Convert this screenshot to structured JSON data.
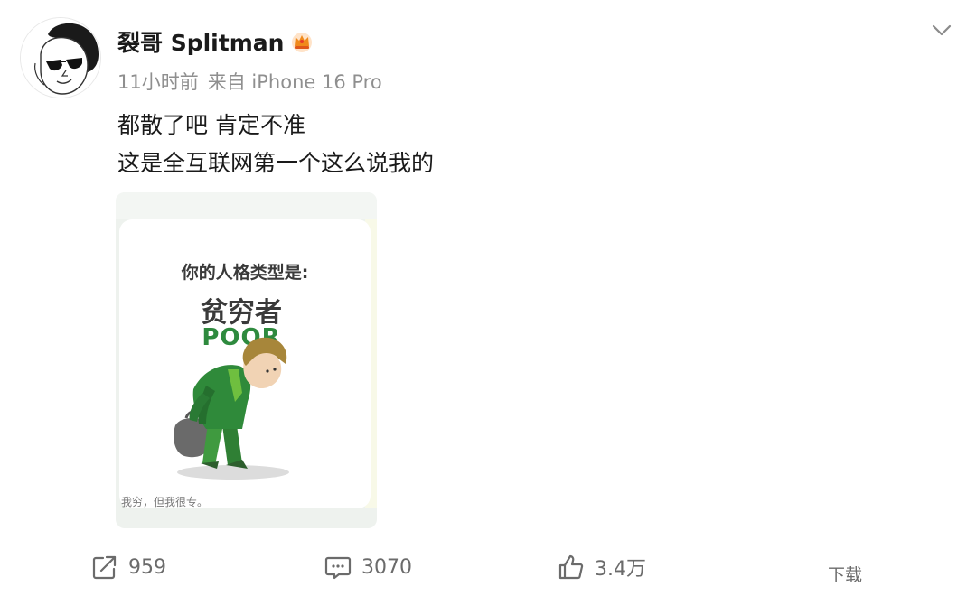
{
  "post": {
    "author": "裂哥 Splitman",
    "time": "11小时前",
    "source": "来自 iPhone 16 Pro",
    "text_line1": "都散了吧 肯定不准",
    "text_line2": "这是全互联网第一个这么说我的"
  },
  "image": {
    "heading": "你的人格类型是:",
    "type_cn": "贫穷者",
    "type_en": "POOR",
    "footer": "我穷，但我很专。"
  },
  "actions": {
    "repost_count": "959",
    "comment_count": "3070",
    "like_count": "3.4万",
    "download_label": "下载"
  },
  "colors": {
    "meta_gray": "#8f8f8f",
    "poor_green": "#2e8a3e"
  }
}
